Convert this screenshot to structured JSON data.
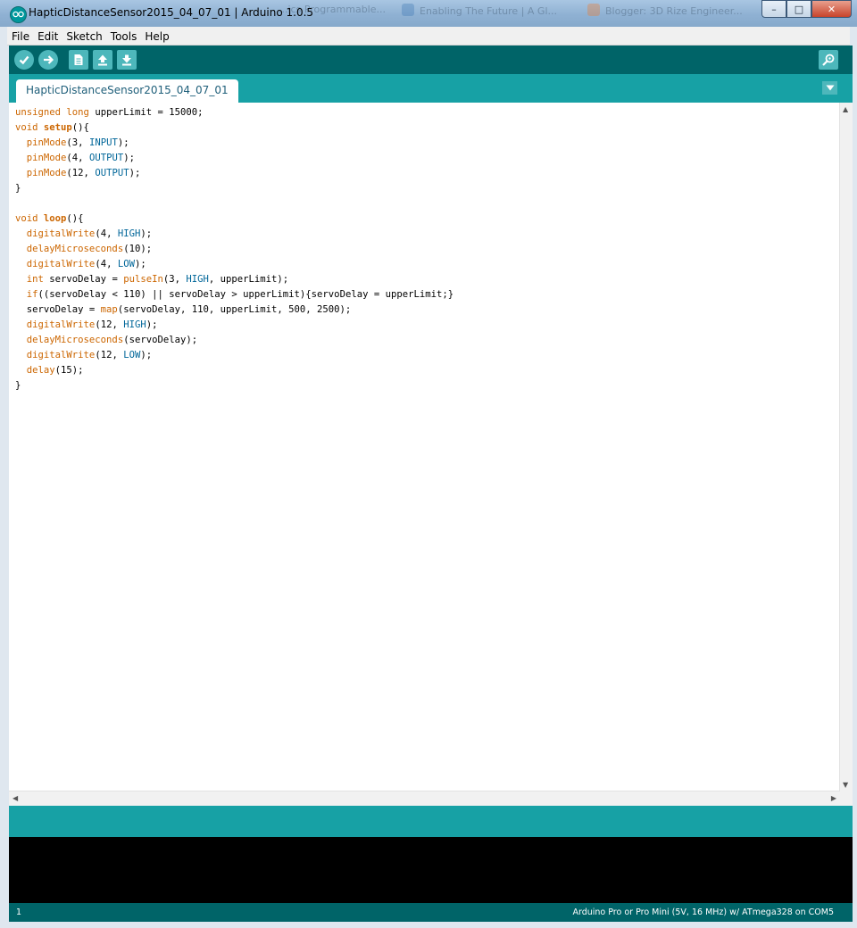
{
  "window": {
    "title": "HapticDistanceSensor2015_04_07_01 | Arduino 1.0.5",
    "background_tabs": [
      "...ics Programmable...",
      "Enabling The Future | A Gl...",
      "Blogger: 3D Rize Engineer..."
    ],
    "controls": {
      "minimize": "–",
      "maximize": "□",
      "close": "✕"
    }
  },
  "menu": [
    "File",
    "Edit",
    "Sketch",
    "Tools",
    "Help"
  ],
  "toolbar": {
    "buttons": [
      "verify-icon",
      "upload-icon",
      "new-icon",
      "open-icon",
      "save-icon"
    ],
    "serial_monitor": "serial-monitor-icon"
  },
  "tab": {
    "label": "HapticDistanceSensor2015_04_07_01"
  },
  "code": [
    [
      {
        "t": "unsigned",
        "c": "kw"
      },
      {
        "t": " "
      },
      {
        "t": "long",
        "c": "kw"
      },
      {
        "t": " upperLimit = 15000;"
      }
    ],
    [
      {
        "t": "void",
        "c": "kw"
      },
      {
        "t": " "
      },
      {
        "t": "setup",
        "c": "kwb"
      },
      {
        "t": "(){"
      }
    ],
    [
      {
        "t": "  "
      },
      {
        "t": "pinMode",
        "c": "kw"
      },
      {
        "t": "(3, "
      },
      {
        "t": "INPUT",
        "c": "cn"
      },
      {
        "t": ");"
      }
    ],
    [
      {
        "t": "  "
      },
      {
        "t": "pinMode",
        "c": "kw"
      },
      {
        "t": "(4, "
      },
      {
        "t": "OUTPUT",
        "c": "cn"
      },
      {
        "t": ");"
      }
    ],
    [
      {
        "t": "  "
      },
      {
        "t": "pinMode",
        "c": "kw"
      },
      {
        "t": "(12, "
      },
      {
        "t": "OUTPUT",
        "c": "cn"
      },
      {
        "t": ");"
      }
    ],
    [
      {
        "t": "}"
      }
    ],
    [
      {
        "t": ""
      }
    ],
    [
      {
        "t": "void",
        "c": "kw"
      },
      {
        "t": " "
      },
      {
        "t": "loop",
        "c": "kwb"
      },
      {
        "t": "(){"
      }
    ],
    [
      {
        "t": "  "
      },
      {
        "t": "digitalWrite",
        "c": "kw"
      },
      {
        "t": "(4, "
      },
      {
        "t": "HIGH",
        "c": "cn"
      },
      {
        "t": ");"
      }
    ],
    [
      {
        "t": "  "
      },
      {
        "t": "delayMicroseconds",
        "c": "kw"
      },
      {
        "t": "(10);"
      }
    ],
    [
      {
        "t": "  "
      },
      {
        "t": "digitalWrite",
        "c": "kw"
      },
      {
        "t": "(4, "
      },
      {
        "t": "LOW",
        "c": "cn"
      },
      {
        "t": ");"
      }
    ],
    [
      {
        "t": "  "
      },
      {
        "t": "int",
        "c": "kw"
      },
      {
        "t": " servoDelay = "
      },
      {
        "t": "pulseIn",
        "c": "kw"
      },
      {
        "t": "(3, "
      },
      {
        "t": "HIGH",
        "c": "cn"
      },
      {
        "t": ", upperLimit);"
      }
    ],
    [
      {
        "t": "  "
      },
      {
        "t": "if",
        "c": "kw"
      },
      {
        "t": "((servoDelay < 110) || servoDelay > upperLimit){servoDelay = upperLimit;}"
      }
    ],
    [
      {
        "t": "  servoDelay = "
      },
      {
        "t": "map",
        "c": "kw"
      },
      {
        "t": "(servoDelay, 110, upperLimit, 500, 2500);"
      }
    ],
    [
      {
        "t": "  "
      },
      {
        "t": "digitalWrite",
        "c": "kw"
      },
      {
        "t": "(12, "
      },
      {
        "t": "HIGH",
        "c": "cn"
      },
      {
        "t": ");"
      }
    ],
    [
      {
        "t": "  "
      },
      {
        "t": "delayMicroseconds",
        "c": "kw"
      },
      {
        "t": "(servoDelay);"
      }
    ],
    [
      {
        "t": "  "
      },
      {
        "t": "digitalWrite",
        "c": "kw"
      },
      {
        "t": "(12, "
      },
      {
        "t": "LOW",
        "c": "cn"
      },
      {
        "t": ");"
      }
    ],
    [
      {
        "t": "  "
      },
      {
        "t": "delay",
        "c": "kw"
      },
      {
        "t": "(15);"
      }
    ],
    [
      {
        "t": "}"
      }
    ]
  ],
  "status": {
    "message": ""
  },
  "footer": {
    "line_number": "1",
    "board": "Arduino Pro or Pro Mini (5V, 16 MHz) w/ ATmega328 on COM5"
  },
  "colors": {
    "toolbar": "#006468",
    "tabbar": "#17a1a5",
    "keyword": "#cc6600",
    "constant": "#006699"
  }
}
